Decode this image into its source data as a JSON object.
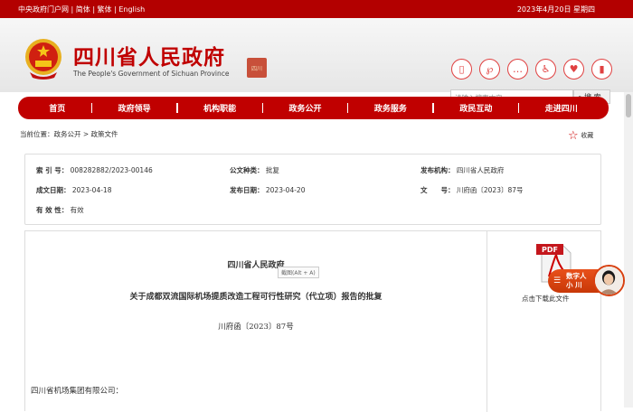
{
  "topbar": {
    "links": "中央政府门户网 | 简体 | 繁体 | English",
    "date": "2023年4月20日 星期四"
  },
  "header": {
    "title": "四川省人民政府",
    "subtitle": "The People's Government of Sichuan Province",
    "seal": "四川",
    "search_placeholder": "请输入搜索内容",
    "search_button": "搜 索",
    "icons": [
      "mobile-icon",
      "weibo-icon",
      "message-icon",
      "accessibility-icon",
      "elderly-care-icon",
      "exit-door-icon"
    ]
  },
  "nav": [
    "首页",
    "政府领导",
    "机构职能",
    "政务公开",
    "政务服务",
    "政民互动",
    "走进四川"
  ],
  "breadcrumb": "当前位置：政务公开 > 政策文件",
  "favorite": "收藏",
  "info": {
    "index_label": "索 引 号：",
    "index": "008282882/2023-00146",
    "type_label": "公文种类：",
    "type": "批复",
    "org_label": "发布机构：",
    "org": "四川省人民政府",
    "written_label": "成文日期：",
    "written": "2023-04-18",
    "pub_label": "发布日期：",
    "pub": "2023-04-20",
    "num_label": "文　　号：",
    "num": "川府函〔2023〕87号",
    "valid_label": "有 效 性：",
    "valid": "有效"
  },
  "doc": {
    "org": "四川省人民政府",
    "tooltip": "截图(Alt + A)",
    "title": "关于成都双流国际机场提质改造工程可行性研究（代立项）报告的批复",
    "number": "川府函〔2023〕87号",
    "addressee": "四川省机场集团有限公司："
  },
  "download": {
    "pdf": "PDF",
    "label": "点击下载此文件"
  },
  "assistant": {
    "line1": "数字人",
    "line2": "小 川"
  }
}
